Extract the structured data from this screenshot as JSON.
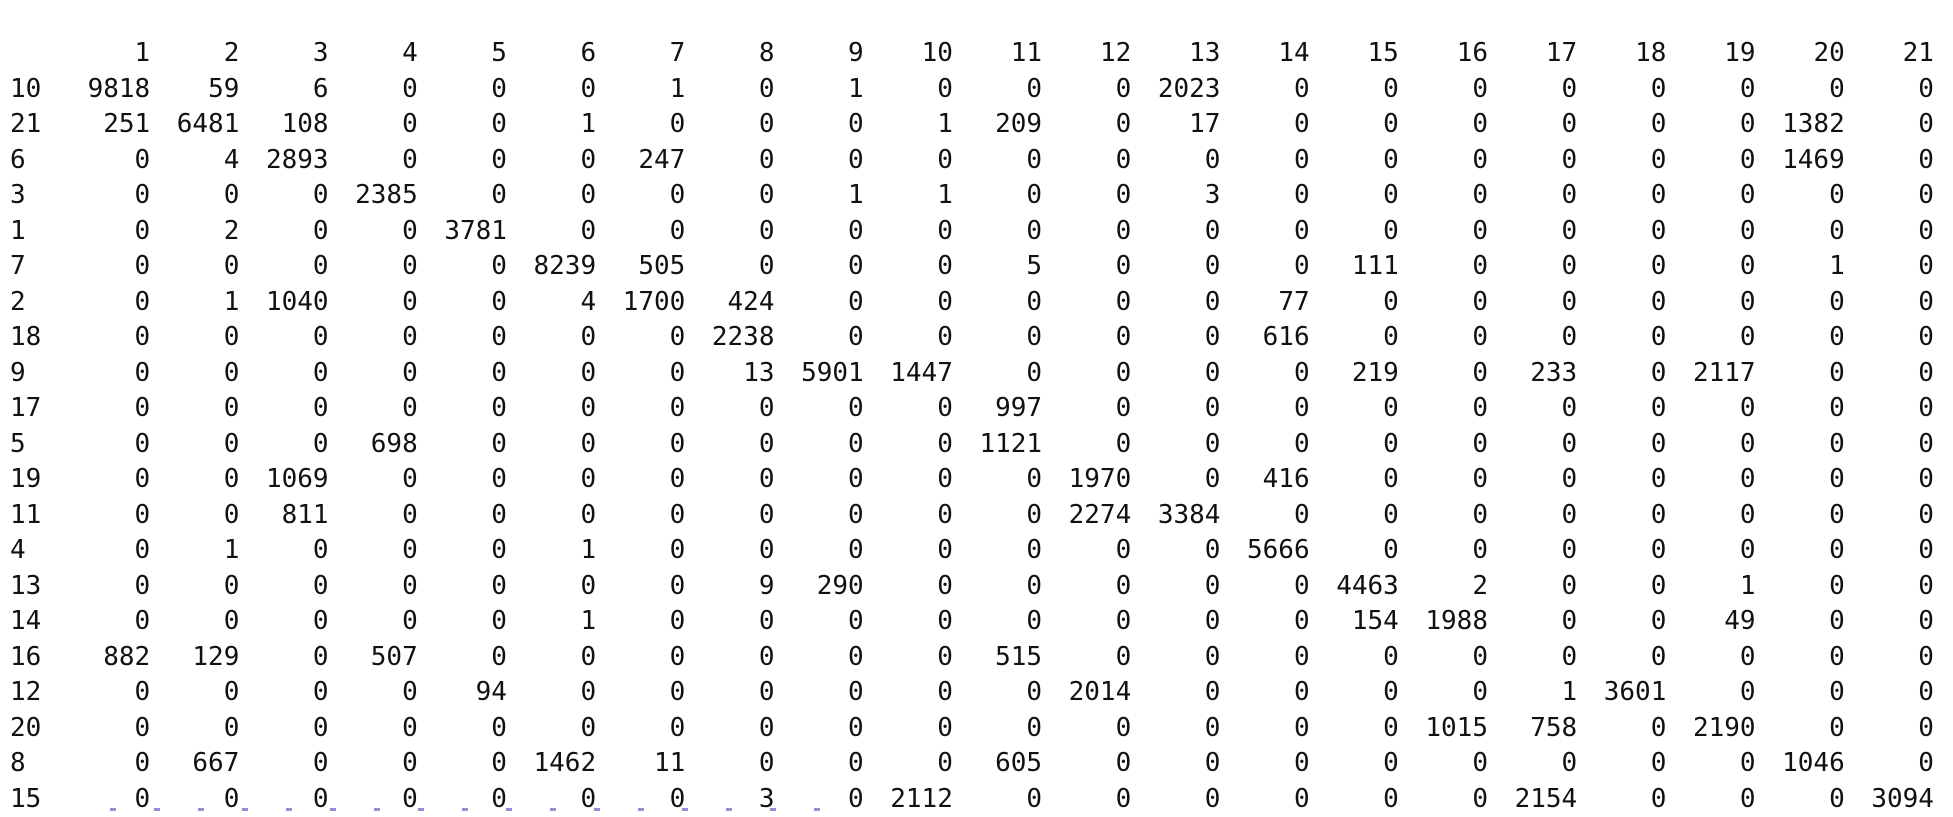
{
  "console": {
    "column_headers": [
      "",
      "1",
      "2",
      "3",
      "4",
      "5",
      "6",
      "7",
      "8",
      "9",
      "10",
      "11",
      "12",
      "13",
      "14",
      "15",
      "16",
      "17",
      "18",
      "19",
      "20",
      "21"
    ],
    "rows": [
      {
        "label": "10",
        "values": [
          "9818",
          "59",
          "6",
          "0",
          "0",
          "0",
          "1",
          "0",
          "1",
          "0",
          "0",
          "0",
          "2023",
          "0",
          "0",
          "0",
          "0",
          "0",
          "0",
          "0",
          "0"
        ]
      },
      {
        "label": "21",
        "values": [
          "251",
          "6481",
          "108",
          "0",
          "0",
          "1",
          "0",
          "0",
          "0",
          "1",
          "209",
          "0",
          "17",
          "0",
          "0",
          "0",
          "0",
          "0",
          "0",
          "1382",
          "0"
        ]
      },
      {
        "label": "6",
        "values": [
          "0",
          "4",
          "2893",
          "0",
          "0",
          "0",
          "247",
          "0",
          "0",
          "0",
          "0",
          "0",
          "0",
          "0",
          "0",
          "0",
          "0",
          "0",
          "0",
          "1469",
          "0"
        ]
      },
      {
        "label": "3",
        "values": [
          "0",
          "0",
          "0",
          "2385",
          "0",
          "0",
          "0",
          "0",
          "1",
          "1",
          "0",
          "0",
          "3",
          "0",
          "0",
          "0",
          "0",
          "0",
          "0",
          "0",
          "0"
        ]
      },
      {
        "label": "1",
        "values": [
          "0",
          "2",
          "0",
          "0",
          "3781",
          "0",
          "0",
          "0",
          "0",
          "0",
          "0",
          "0",
          "0",
          "0",
          "0",
          "0",
          "0",
          "0",
          "0",
          "0",
          "0"
        ]
      },
      {
        "label": "7",
        "values": [
          "0",
          "0",
          "0",
          "0",
          "0",
          "8239",
          "505",
          "0",
          "0",
          "0",
          "5",
          "0",
          "0",
          "0",
          "111",
          "0",
          "0",
          "0",
          "0",
          "1",
          "0"
        ]
      },
      {
        "label": "2",
        "values": [
          "0",
          "1",
          "1040",
          "0",
          "0",
          "4",
          "1700",
          "424",
          "0",
          "0",
          "0",
          "0",
          "0",
          "77",
          "0",
          "0",
          "0",
          "0",
          "0",
          "0",
          "0"
        ]
      },
      {
        "label": "18",
        "values": [
          "0",
          "0",
          "0",
          "0",
          "0",
          "0",
          "0",
          "2238",
          "0",
          "0",
          "0",
          "0",
          "0",
          "616",
          "0",
          "0",
          "0",
          "0",
          "0",
          "0",
          "0"
        ]
      },
      {
        "label": "9",
        "values": [
          "0",
          "0",
          "0",
          "0",
          "0",
          "0",
          "0",
          "13",
          "5901",
          "1447",
          "0",
          "0",
          "0",
          "0",
          "219",
          "0",
          "233",
          "0",
          "2117",
          "0",
          "0"
        ]
      },
      {
        "label": "17",
        "values": [
          "0",
          "0",
          "0",
          "0",
          "0",
          "0",
          "0",
          "0",
          "0",
          "0",
          "997",
          "0",
          "0",
          "0",
          "0",
          "0",
          "0",
          "0",
          "0",
          "0",
          "0"
        ]
      },
      {
        "label": "5",
        "values": [
          "0",
          "0",
          "0",
          "698",
          "0",
          "0",
          "0",
          "0",
          "0",
          "0",
          "1121",
          "0",
          "0",
          "0",
          "0",
          "0",
          "0",
          "0",
          "0",
          "0",
          "0"
        ]
      },
      {
        "label": "19",
        "values": [
          "0",
          "0",
          "1069",
          "0",
          "0",
          "0",
          "0",
          "0",
          "0",
          "0",
          "0",
          "1970",
          "0",
          "416",
          "0",
          "0",
          "0",
          "0",
          "0",
          "0",
          "0"
        ]
      },
      {
        "label": "11",
        "values": [
          "0",
          "0",
          "811",
          "0",
          "0",
          "0",
          "0",
          "0",
          "0",
          "0",
          "0",
          "2274",
          "3384",
          "0",
          "0",
          "0",
          "0",
          "0",
          "0",
          "0",
          "0"
        ]
      },
      {
        "label": "4",
        "values": [
          "0",
          "1",
          "0",
          "0",
          "0",
          "1",
          "0",
          "0",
          "0",
          "0",
          "0",
          "0",
          "0",
          "5666",
          "0",
          "0",
          "0",
          "0",
          "0",
          "0",
          "0"
        ]
      },
      {
        "label": "13",
        "values": [
          "0",
          "0",
          "0",
          "0",
          "0",
          "0",
          "0",
          "9",
          "290",
          "0",
          "0",
          "0",
          "0",
          "0",
          "4463",
          "2",
          "0",
          "0",
          "1",
          "0",
          "0"
        ]
      },
      {
        "label": "14",
        "values": [
          "0",
          "0",
          "0",
          "0",
          "0",
          "1",
          "0",
          "0",
          "0",
          "0",
          "0",
          "0",
          "0",
          "0",
          "154",
          "1988",
          "0",
          "0",
          "49",
          "0",
          "0"
        ]
      },
      {
        "label": "16",
        "values": [
          "882",
          "129",
          "0",
          "507",
          "0",
          "0",
          "0",
          "0",
          "0",
          "0",
          "515",
          "0",
          "0",
          "0",
          "0",
          "0",
          "0",
          "0",
          "0",
          "0",
          "0"
        ]
      },
      {
        "label": "12",
        "values": [
          "0",
          "0",
          "0",
          "0",
          "94",
          "0",
          "0",
          "0",
          "0",
          "0",
          "0",
          "2014",
          "0",
          "0",
          "0",
          "0",
          "1",
          "3601",
          "0",
          "0",
          "0"
        ]
      },
      {
        "label": "20",
        "values": [
          "0",
          "0",
          "0",
          "0",
          "0",
          "0",
          "0",
          "0",
          "0",
          "0",
          "0",
          "0",
          "0",
          "0",
          "0",
          "1015",
          "758",
          "0",
          "2190",
          "0",
          "0"
        ]
      },
      {
        "label": "8",
        "values": [
          "0",
          "667",
          "0",
          "0",
          "0",
          "1462",
          "11",
          "0",
          "0",
          "0",
          "605",
          "0",
          "0",
          "0",
          "0",
          "0",
          "0",
          "0",
          "0",
          "1046",
          "0"
        ]
      },
      {
        "label": "15",
        "values": [
          "0",
          "0",
          "0",
          "0",
          "0",
          "0",
          "0",
          "3",
          "0",
          "2112",
          "0",
          "0",
          "0",
          "0",
          "0",
          "0",
          "2154",
          "0",
          "0",
          "0",
          "3094"
        ]
      }
    ]
  }
}
